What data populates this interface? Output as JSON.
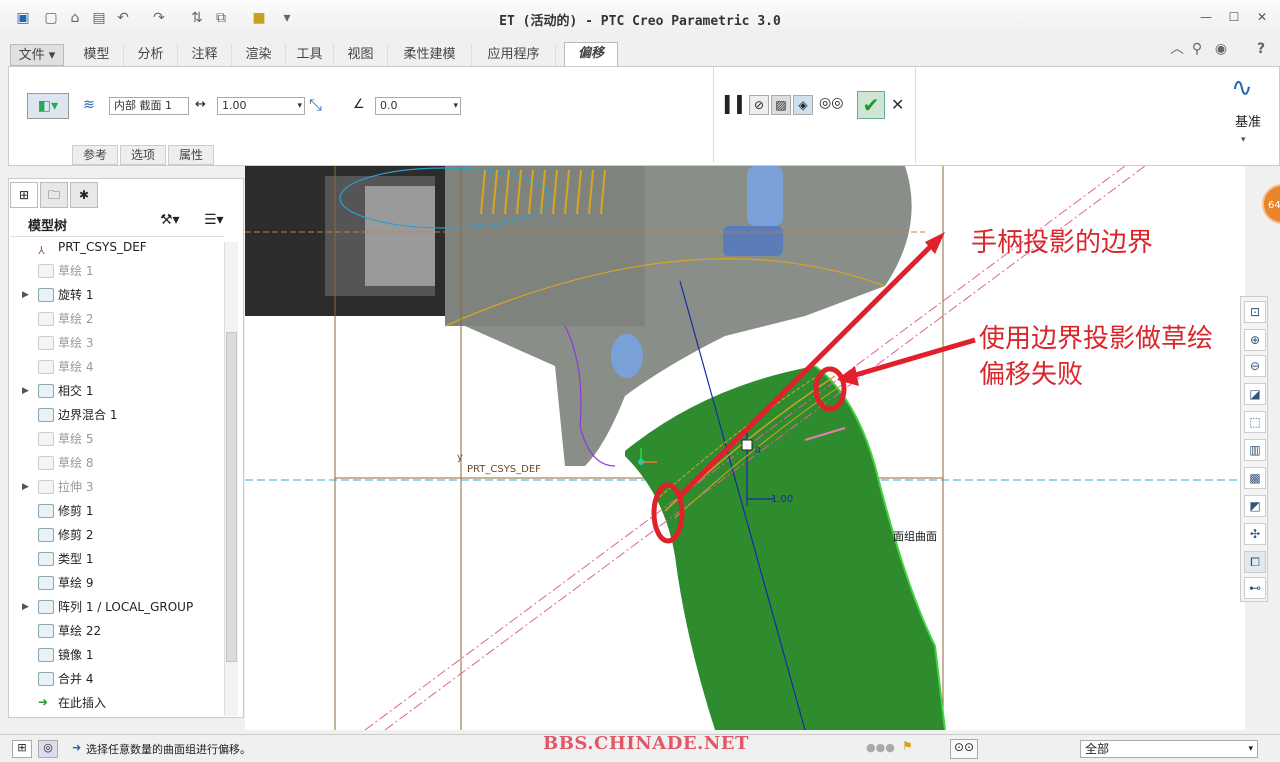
{
  "window": {
    "title": "ET (活动的) - PTC Creo Parametric 3.0"
  },
  "tabs": [
    {
      "label": "文件",
      "has_menu": true
    },
    {
      "label": "模型"
    },
    {
      "label": "分析"
    },
    {
      "label": "注释"
    },
    {
      "label": "渲染"
    },
    {
      "label": "工具"
    },
    {
      "label": "视图"
    },
    {
      "label": "柔性建模"
    },
    {
      "label": "应用程序"
    },
    {
      "label": "偏移",
      "active": true
    }
  ],
  "ribbon": {
    "section_select": "内部 截面 1",
    "offset_value": "1.00",
    "angle_value": "0.0",
    "subtabs": [
      "参考",
      "选项",
      "属性"
    ],
    "datum_label": "基准"
  },
  "panel": {
    "title": "模型树",
    "items": [
      {
        "label": "PRT_CSYS_DEF",
        "state": "normal",
        "expand": false,
        "icon": "csys-icon"
      },
      {
        "label": "草绘 1",
        "state": "gray",
        "expand": false,
        "icon": "sketch-icon"
      },
      {
        "label": "旋转 1",
        "state": "normal",
        "expand": true,
        "icon": "revolve-icon"
      },
      {
        "label": "草绘 2",
        "state": "gray",
        "expand": false,
        "icon": "sketch-icon"
      },
      {
        "label": "草绘 3",
        "state": "gray",
        "expand": false,
        "icon": "sketch-icon"
      },
      {
        "label": "草绘 4",
        "state": "gray",
        "expand": false,
        "icon": "sketch-icon"
      },
      {
        "label": "相交 1",
        "state": "normal",
        "expand": true,
        "icon": "intersect-icon"
      },
      {
        "label": "边界混合 1",
        "state": "normal",
        "expand": false,
        "icon": "boundary-blend-icon"
      },
      {
        "label": "草绘 5",
        "state": "gray",
        "expand": false,
        "icon": "sketch-icon"
      },
      {
        "label": "草绘 8",
        "state": "gray",
        "expand": false,
        "icon": "sketch-icon"
      },
      {
        "label": "拉伸 3",
        "state": "gray",
        "expand": true,
        "icon": "extrude-icon"
      },
      {
        "label": "修剪 1",
        "state": "normal",
        "expand": false,
        "icon": "trim-icon"
      },
      {
        "label": "修剪 2",
        "state": "normal",
        "expand": false,
        "icon": "trim-icon"
      },
      {
        "label": "类型 1",
        "state": "normal",
        "expand": false,
        "icon": "style-icon"
      },
      {
        "label": "草绘 9",
        "state": "normal",
        "expand": false,
        "icon": "sketch-icon"
      },
      {
        "label": "阵列 1 / LOCAL_GROUP",
        "state": "normal",
        "expand": true,
        "icon": "pattern-icon"
      },
      {
        "label": "草绘 22",
        "state": "normal",
        "expand": false,
        "icon": "sketch-icon"
      },
      {
        "label": "镜像 1",
        "state": "normal",
        "expand": false,
        "icon": "mirror-icon"
      },
      {
        "label": "合并 4",
        "state": "normal",
        "expand": false,
        "icon": "merge-icon"
      },
      {
        "label": "在此插入",
        "state": "insert",
        "expand": false,
        "icon": "insert-arrow-icon"
      }
    ]
  },
  "canvas": {
    "csys_label": "PRT_CSYS_DEF",
    "dim_label": "1.00",
    "surface_label": "面组曲面",
    "axis_y_label": "y",
    "point_label": "0"
  },
  "annotations": {
    "a1": "手柄投影的边界",
    "a2_line1": "使用边界投影做草绘",
    "a2_line2": "偏移失败"
  },
  "status": {
    "message": "选择任意数量的曲面组进行偏移。",
    "filter": "全部",
    "badge": "64"
  },
  "watermark": "BBS.CHINADE.NET",
  "colors": {
    "green_surface": "#2e8b2e",
    "annotation_red": "#d8262b",
    "accent_blue": "#2b5fa8"
  }
}
